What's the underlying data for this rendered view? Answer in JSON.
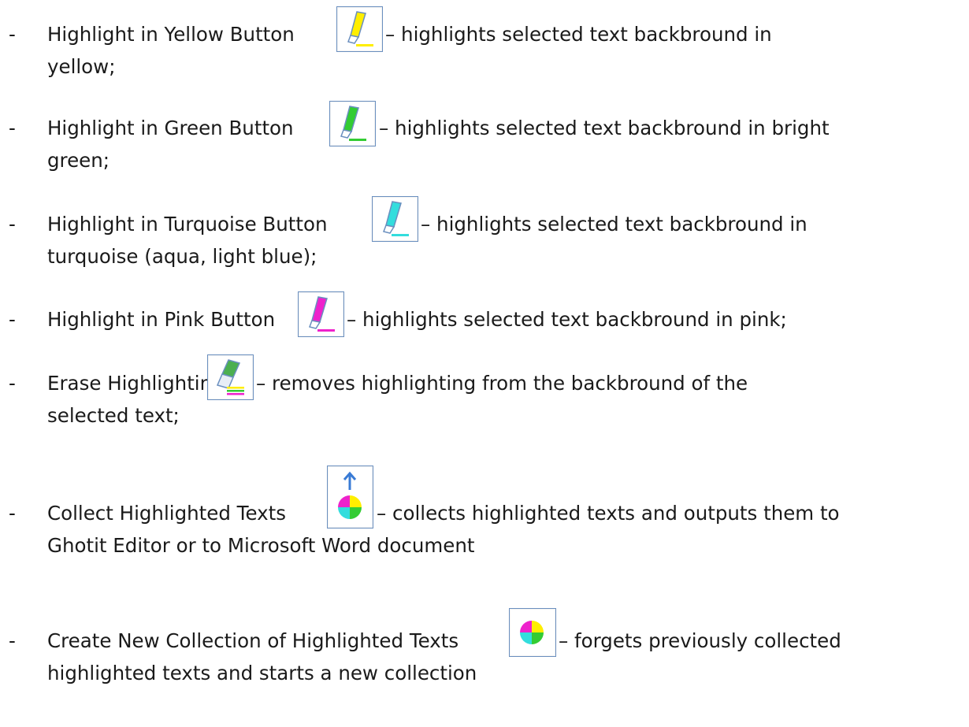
{
  "items": [
    {
      "bullet": "-",
      "label": "Highlight in Yellow Button",
      "desc": "– highlights selected text backbround in",
      "desc2": "yellow;",
      "icon": "yellow-highlighter-icon",
      "color": "#ffee00"
    },
    {
      "bullet": "-",
      "label": "Highlight in Green Button",
      "desc": "– highlights selected text backbround in bright",
      "desc2": "green;",
      "icon": "green-highlighter-icon",
      "color": "#33cc33"
    },
    {
      "bullet": "-",
      "label": "Highlight in Turquoise Button",
      "desc": "– highlights selected text backbround in",
      "desc2": "turquoise (aqua, light blue);",
      "icon": "turquoise-highlighter-icon",
      "color": "#33dddd"
    },
    {
      "bullet": "-",
      "label": "Highlight in Pink Button",
      "desc": "– highlights selected text backbround in pink;",
      "icon": "pink-highlighter-icon",
      "color": "#ee22cc"
    },
    {
      "bullet": "-",
      "label": "Erase Highlighting",
      "desc": "– removes highlighting from the backbround of the",
      "desc2": "selected text;",
      "icon": "eraser-icon"
    },
    {
      "bullet": "-",
      "label": "Collect Highlighted Texts",
      "desc": "– collects highlighted texts and outputs them to",
      "desc2": "Ghotit Editor or to Microsoft Word document",
      "icon": "collect-highlighted-icon"
    },
    {
      "bullet": "-",
      "label": "Create New Collection of Highlighted Texts",
      "desc": "– forgets previously collected",
      "desc2": "highlighted texts and starts a new collection",
      "icon": "new-collection-icon"
    }
  ]
}
